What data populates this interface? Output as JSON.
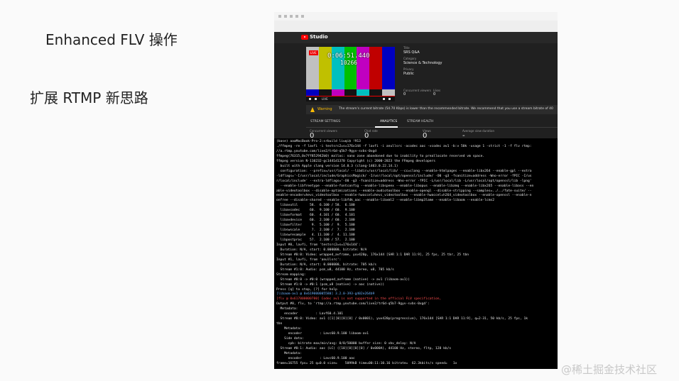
{
  "slide": {
    "title": "Enhanced FLV 操作",
    "subtitle": "扩展 RTMP 新思路",
    "watermark": "@稀土掘金技术社区"
  },
  "studio": {
    "app_name": "Studio",
    "video": {
      "live_badge": "LIVE",
      "counter": "0:06:51.440",
      "counter2": "10266",
      "live_control": "LIVE"
    },
    "meta": {
      "title_label": "Title",
      "title_value": "SRS Q&A",
      "category_label": "Category",
      "category_value": "Science & Technology",
      "privacy_label": "Privacy",
      "privacy_value": "Public",
      "viewers_label": "Concurrent viewers",
      "viewers_value": "0",
      "likes_label": "Likes",
      "likes_value": "0"
    },
    "warning": {
      "label": "Warning",
      "text": "The stream's current bitrate (54.70 Kbps) is lower than the recommended bitrate. We recommend that you use a stream bitrate of 40"
    },
    "tabs": [
      {
        "label": "STREAM SETTINGS"
      },
      {
        "label": "ANALYTICS"
      },
      {
        "label": "STREAM HEALTH"
      }
    ],
    "stats": [
      {
        "label": "Concurrent viewers",
        "value": "0"
      },
      {
        "label": "Chat rate",
        "value": "0"
      },
      {
        "label": "Views",
        "value": "0"
      },
      {
        "label": "Average view duration",
        "value": "-"
      }
    ],
    "colors": {
      "bars": [
        "#c0c0c0",
        "#c0c000",
        "#00c0c0",
        "#00c000",
        "#c000c0",
        "#c00000",
        "#0000c0"
      ],
      "strip": [
        "#0000c0",
        "#131313",
        "#c000c0",
        "#131313",
        "#00c0c0",
        "#131313",
        "#c0c0c0"
      ]
    }
  },
  "terminal": {
    "lines": [
      {
        "text": "(base) aaaMacBook-Pro-2:srbuild liuqi$ !913",
        "style": "normal"
      },
      {
        "text": "./ffmpeg -re -f lavfi -i testsrc2=s=176x144 -f lavfi -i anullsrc -acodec aac -vcodec av1 -b:v 50k -usage 1 -strict -1 -f flv rtmp:",
        "style": "normal"
      },
      {
        "text": "//a.rtmp.youtube.com/live2/tr6d-q5b7-9gyv-svbs-0xgd",
        "style": "normal"
      },
      {
        "text": "ffmpeg(76315,0x7ff852942b0) malloc: nano zone abandoned due to inability to preallocate reserved vm space.",
        "style": "normal"
      },
      {
        "text": "ffmpeg version N-110232-gc1441d1370 Copyright (c) 2000-2023 the FFmpeg developers",
        "style": "normal"
      },
      {
        "text": "  built with Apple clang version 14.0.3 (clang-1403.0.22.14.1)",
        "style": "normal"
      },
      {
        "text": "  configuration: --prefix=/usr/local/ --libdir=/usr/local/lib/ --cc=clang --enable-htmlpages --enable-libx264 --enable-gpl --extra",
        "style": "normal"
      },
      {
        "text": "-ldflags='-I/usr/local/include/GraphicsMagick/ -I/usr/local/opt/openssl/include/ -O0 -g3 -fsanitize=address -Wno-error -fPIC -I/us",
        "style": "normal"
      },
      {
        "text": "r/local/include' --extra-ldflags='-O0 -g3 -fsanitize=address -Wno-error -fPIC -L/usr/local/lib -L/usr/local/opt/openssl/lib -lpng'",
        "style": "normal"
      },
      {
        "text": "  --enable-libfreetype --enable-fontconfig --enable-libspeex --enable-libopus --enable-libzmq --enable-libx265 --enable-libass --en",
        "style": "normal"
      },
      {
        "text": "able-videotoolbox --disable-optimizations --enable-audiotoolbox --enable-opengl --disable-stripping --samples=../../fate-suite/ --",
        "style": "normal"
      },
      {
        "text": "enable-encoder=hevc_videotoolbox --enable-hwaccel=hevc_videotoolbox --enable-hwaccel=h264_videotoolbox --enable-openssl --enable-n",
        "style": "normal"
      },
      {
        "text": "onfree --disable-shared --enable-libfdk_aac --enable-libxml2 --enable-libmp3lame --enable-libaom --enable-lcms2",
        "style": "normal"
      },
      {
        "text": "  libavutil      58.  6.100 / 58.  6.100",
        "style": "normal"
      },
      {
        "text": "  libavcodec     60.  9.100 / 60.  9.100",
        "style": "normal"
      },
      {
        "text": "  libavformat    60.  4.101 / 60.  4.101",
        "style": "normal"
      },
      {
        "text": "  libavdevice    60.  2.100 / 60.  2.100",
        "style": "normal"
      },
      {
        "text": "  libavfilter     9.  5.100 /  9.  5.100",
        "style": "normal"
      },
      {
        "text": "  libswscale      7.  2.100 /  7.  2.100",
        "style": "normal"
      },
      {
        "text": "  libswresample   4. 11.100 /  4. 11.100",
        "style": "normal"
      },
      {
        "text": "  libpostproc    57.  2.100 / 57.  2.100",
        "style": "normal"
      },
      {
        "text": "Input #0, lavfi, from 'testsrc2=s=176x144':",
        "style": "normal"
      },
      {
        "text": "  Duration: N/A, start: 0.000000, bitrate: N/A",
        "style": "normal"
      },
      {
        "text": "  Stream #0:0: Video: wrapped_avframe, yuv420p, 176x144 [SAR 1:1 DAR 11:9], 25 fps, 25 tbr, 25 tbn",
        "style": "normal"
      },
      {
        "text": "Input #1, lavfi, from 'anullsrc':",
        "style": "normal"
      },
      {
        "text": "  Duration: N/A, start: 0.000000, bitrate: 705 kb/s",
        "style": "normal"
      },
      {
        "text": "  Stream #1:0: Audio: pcm_u8, 44100 Hz, stereo, u8, 705 kb/s",
        "style": "normal"
      },
      {
        "text": "Stream mapping:",
        "style": "normal"
      },
      {
        "text": "  Stream #0:0 -> #0:0 (wrapped_avframe (native) -> av1 (libaom-av1))",
        "style": "normal"
      },
      {
        "text": "  Stream #1:0 -> #0:1 (pcm_u8 (native) -> aac (native))",
        "style": "normal"
      },
      {
        "text": "Press [q] to stop, [?] for help",
        "style": "normal"
      },
      {
        "text": "[libaom-av1 @ 0x619000005580] 3.2.0-393-g402e264b9",
        "style": "blue"
      },
      {
        "text": "[flv @ 0x617000000780] Codec av1 is not supported in the official FLV specification,",
        "style": "red"
      },
      {
        "text": "Output #0, flv, to 'rtmp://a.rtmp.youtube.com/live2/tr6d-q5b7-9gyv-svbs-0xgd':",
        "style": "normal"
      },
      {
        "text": "  Metadata:",
        "style": "normal"
      },
      {
        "text": "    encoder         : Lavf60.4.101",
        "style": "normal"
      },
      {
        "text": "  Stream #0:0: Video: av1 ([1][0][0][0] / 0x0001), yuv420p(progressive), 176x144 [SAR 1:1 DAR 11:9], q=2-31, 50 kb/s, 25 fps, 1k",
        "style": "normal"
      },
      {
        "text": "tbn",
        "style": "normal"
      },
      {
        "text": "    Metadata:",
        "style": "normal"
      },
      {
        "text": "      encoder         : Lavc60.9.100 libaom-av1",
        "style": "normal"
      },
      {
        "text": "    Side data:",
        "style": "normal"
      },
      {
        "text": "      cpb: bitrate max/min/avg: 0/0/50000 buffer size: 0 vbv_delay: N/A",
        "style": "normal"
      },
      {
        "text": "  Stream #0:1: Audio: aac (LC) ([10][0][0][0] / 0x000A), 44100 Hz, stereo, fltp, 128 kb/s",
        "style": "normal"
      },
      {
        "text": "    Metadata:",
        "style": "normal"
      },
      {
        "text": "      encoder         : Lavc60.9.100 aac",
        "style": "normal"
      },
      {
        "text": "frame=16755 fps= 25 q=0.0 size=    5099kB time=00:11:10.16 bitrate=  62.3kbits/s speed=   1x",
        "style": "normal"
      }
    ]
  }
}
